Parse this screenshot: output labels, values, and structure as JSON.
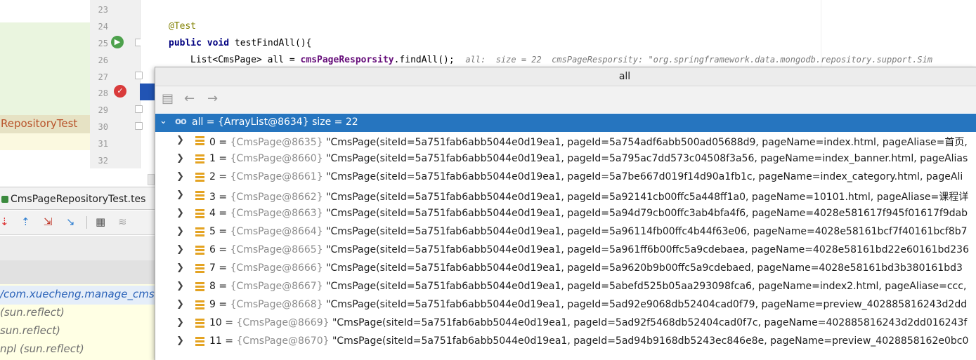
{
  "editor": {
    "line_numbers": [
      "23",
      "24",
      "25",
      "26",
      "27",
      "28",
      "29",
      "30",
      "31",
      "32"
    ],
    "annotation": "@Test",
    "method_kw_public": "public",
    "method_kw_void": "void",
    "method_signature": " testFindAll(){",
    "line26_pre": "List<CmsPage> all = ",
    "line26_field": "cmsPageResporsity",
    "line26_post": ".findAll();",
    "inline_hint": "all:  size = 22  cmsPageResporsity: \"org.springframework.data.mongodb.repository.support.Sim"
  },
  "left_panel": {
    "project_item_label": "RepositoryTest",
    "run_tab_label": "CmsPageRepositoryTest.tes",
    "frames": [
      {
        "text": "/com.xuecheng.manage_cms.d",
        "selected": true
      },
      {
        "text": "(sun.reflect)",
        "selected": false
      },
      {
        "text": "sun.reflect)",
        "selected": false
      },
      {
        "text": "npl (sun.reflect)",
        "selected": false
      }
    ]
  },
  "popup": {
    "title": "all",
    "root": {
      "name": "all",
      "eq": " = ",
      "ref": "{ArrayList@8634}",
      "size": " size = 22"
    },
    "items": [
      {
        "index": "0",
        "ref": "{CmsPage@8635}",
        "value": "\"CmsPage(siteId=5a751fab6abb5044e0d19ea1, pageId=5a754adf6abb500ad05688d9, pageName=index.html, pageAliase=首页,"
      },
      {
        "index": "1",
        "ref": "{CmsPage@8660}",
        "value": "\"CmsPage(siteId=5a751fab6abb5044e0d19ea1, pageId=5a795ac7dd573c04508f3a56, pageName=index_banner.html, pageAlias"
      },
      {
        "index": "2",
        "ref": "{CmsPage@8661}",
        "value": "\"CmsPage(siteId=5a751fab6abb5044e0d19ea1, pageId=5a7be667d019f14d90a1fb1c, pageName=index_category.html, pageAli"
      },
      {
        "index": "3",
        "ref": "{CmsPage@8662}",
        "value": "\"CmsPage(siteId=5a751fab6abb5044e0d19ea1, pageId=5a92141cb00ffc5a448ff1a0, pageName=10101.html, pageAliase=课程详"
      },
      {
        "index": "4",
        "ref": "{CmsPage@8663}",
        "value": "\"CmsPage(siteId=5a751fab6abb5044e0d19ea1, pageId=5a94d79cb00ffc3ab4bfa4f6, pageName=4028e581617f945f01617f9dab"
      },
      {
        "index": "5",
        "ref": "{CmsPage@8664}",
        "value": "\"CmsPage(siteId=5a751fab6abb5044e0d19ea1, pageId=5a96114fb00ffc4b44f63e06, pageName=4028e58161bcf7f40161bcf8b7"
      },
      {
        "index": "6",
        "ref": "{CmsPage@8665}",
        "value": "\"CmsPage(siteId=5a751fab6abb5044e0d19ea1, pageId=5a961ff6b00ffc5a9cdebaea, pageName=4028e58161bd22e60161bd236"
      },
      {
        "index": "7",
        "ref": "{CmsPage@8666}",
        "value": "\"CmsPage(siteId=5a751fab6abb5044e0d19ea1, pageId=5a9620b9b00ffc5a9cdebaed, pageName=4028e58161bd3b380161bd3"
      },
      {
        "index": "8",
        "ref": "{CmsPage@8667}",
        "value": "\"CmsPage(siteId=5a751fab6abb5044e0d19ea1, pageId=5abefd525b05aa293098fca6, pageName=index2.html, pageAliase=ccc,"
      },
      {
        "index": "9",
        "ref": "{CmsPage@8668}",
        "value": "\"CmsPage(siteId=5a751fab6abb5044e0d19ea1, pageId=5ad92e9068db52404cad0f79, pageName=preview_402885816243d2dd"
      },
      {
        "index": "10",
        "ref": "{CmsPage@8669}",
        "value": "\"CmsPage(siteId=5a751fab6abb5044e0d19ea1, pageId=5ad92f5468db52404cad0f7c, pageName=402885816243d2dd016243f"
      },
      {
        "index": "11",
        "ref": "{CmsPage@8670}",
        "value": "\"CmsPage(siteId=5a751fab6abb5044e0d19ea1, pageId=5ad94b9168db5243ec846e8e, pageName=preview_4028858162e0bc0"
      }
    ]
  }
}
